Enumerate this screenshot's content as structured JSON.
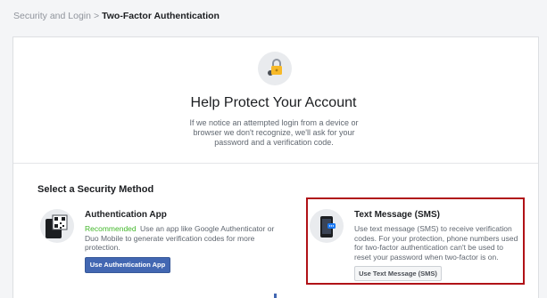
{
  "breadcrumb": {
    "parent": "Security and Login",
    "separator": ">",
    "current": "Two-Factor Authentication"
  },
  "hero": {
    "icon": "lock-key-icon",
    "title": "Help Protect Your Account",
    "text": "If we notice an attempted login from a device or browser we don't recognize, we'll ask for your password and a verification code."
  },
  "methods": {
    "section_title": "Select a Security Method",
    "items": [
      {
        "icon": "qr-code-icon",
        "title": "Authentication App",
        "recommended": "Recommended",
        "description": "Use an app like Google Authenticator or Duo Mobile to generate verification codes for more protection.",
        "button": "Use Authentication App"
      },
      {
        "icon": "phone-sms-icon",
        "title": "Text Message (SMS)",
        "description": "Use text message (SMS) to receive verification codes. For your protection, phone numbers used for two-factor authentication can't be used to reset your password when two-factor is on.",
        "button": "Use Text Message (SMS)"
      }
    ]
  },
  "colors": {
    "primary_button": "#4267b2",
    "recommended": "#42b72a",
    "highlight_border": "#b01217"
  }
}
